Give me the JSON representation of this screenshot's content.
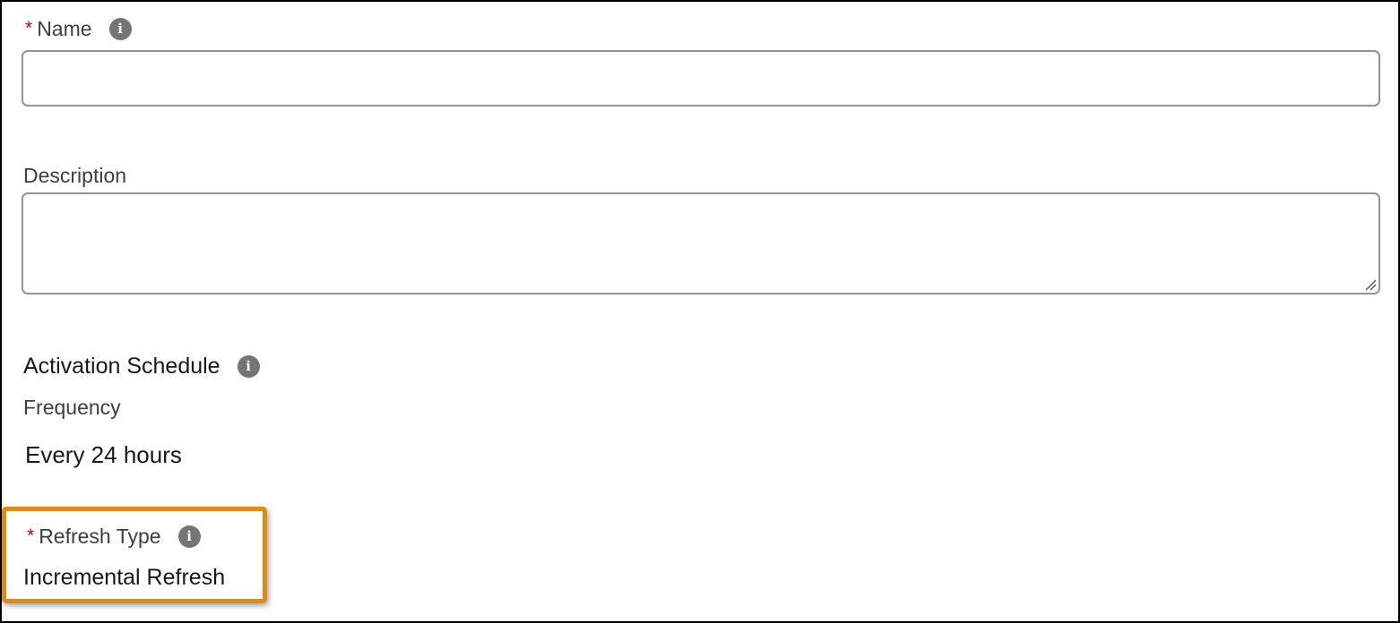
{
  "form": {
    "name": {
      "required_mark": "*",
      "label": "Name",
      "value": "",
      "info_icon": "info-icon"
    },
    "description": {
      "label": "Description",
      "value": ""
    },
    "activation_schedule": {
      "title": "Activation Schedule",
      "info_icon": "info-icon",
      "frequency_label": "Frequency",
      "frequency_value": "Every 24 hours"
    },
    "refresh_type": {
      "required_mark": "*",
      "label": "Refresh Type",
      "info_icon": "info-icon",
      "value": "Incremental Refresh"
    }
  },
  "colors": {
    "required": "#ba0517",
    "highlight": "#e08a0e",
    "info_icon_bg": "#747474",
    "input_border": "#939393"
  }
}
